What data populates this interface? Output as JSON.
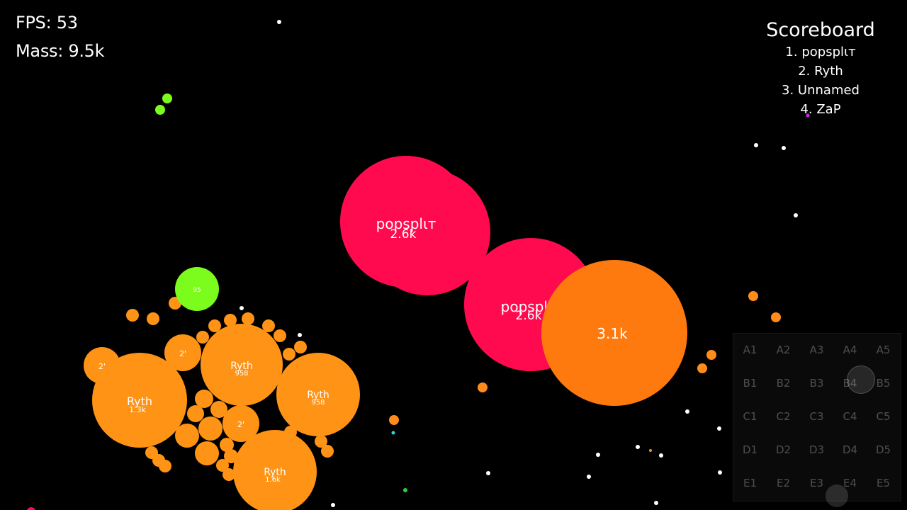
{
  "hud": {
    "fps_label": "FPS",
    "fps_value": "53",
    "mass_label": "Mass",
    "mass_value": "9.5k"
  },
  "scoreboard": {
    "title": "Scoreboard",
    "entries": [
      {
        "rank": "1",
        "name": "popsplιт"
      },
      {
        "rank": "2",
        "name": "Ryth"
      },
      {
        "rank": "3",
        "name": "Unnamed"
      },
      {
        "rank": "4",
        "name": "ZaP"
      }
    ]
  },
  "minimap": {
    "sectors": [
      "A1",
      "A2",
      "A3",
      "A4",
      "A5",
      "B1",
      "B2",
      "B3",
      "B4",
      "B5",
      "C1",
      "C2",
      "C3",
      "C4",
      "C5",
      "D1",
      "D2",
      "D3",
      "D4",
      "D5",
      "E1",
      "E2",
      "E3",
      "E4",
      "E5"
    ]
  },
  "players": {
    "popsplit": {
      "name": "popsplιт",
      "color": "#ff0a4e",
      "cells": [
        {
          "mass": "2.6k"
        },
        {
          "mass": "2.6k"
        }
      ]
    },
    "orange_big": {
      "name": "",
      "color": "#ff7a0e",
      "mass": "3.1k"
    },
    "ryth": {
      "name": "Ryth",
      "color": "#ff9316",
      "cells": [
        {
          "mass": "1.3k"
        },
        {
          "mass": "958"
        },
        {
          "mass": "958"
        },
        {
          "mass": "1.6k"
        }
      ],
      "small_label": "2'"
    },
    "green": {
      "color": "#7cfc1c",
      "label": "95"
    }
  },
  "colors": {
    "food_white": "#ffffff",
    "food_green": "#7cfc1c",
    "food_orange": "#ff8c1a",
    "food_cyan": "#2ed3e0"
  }
}
